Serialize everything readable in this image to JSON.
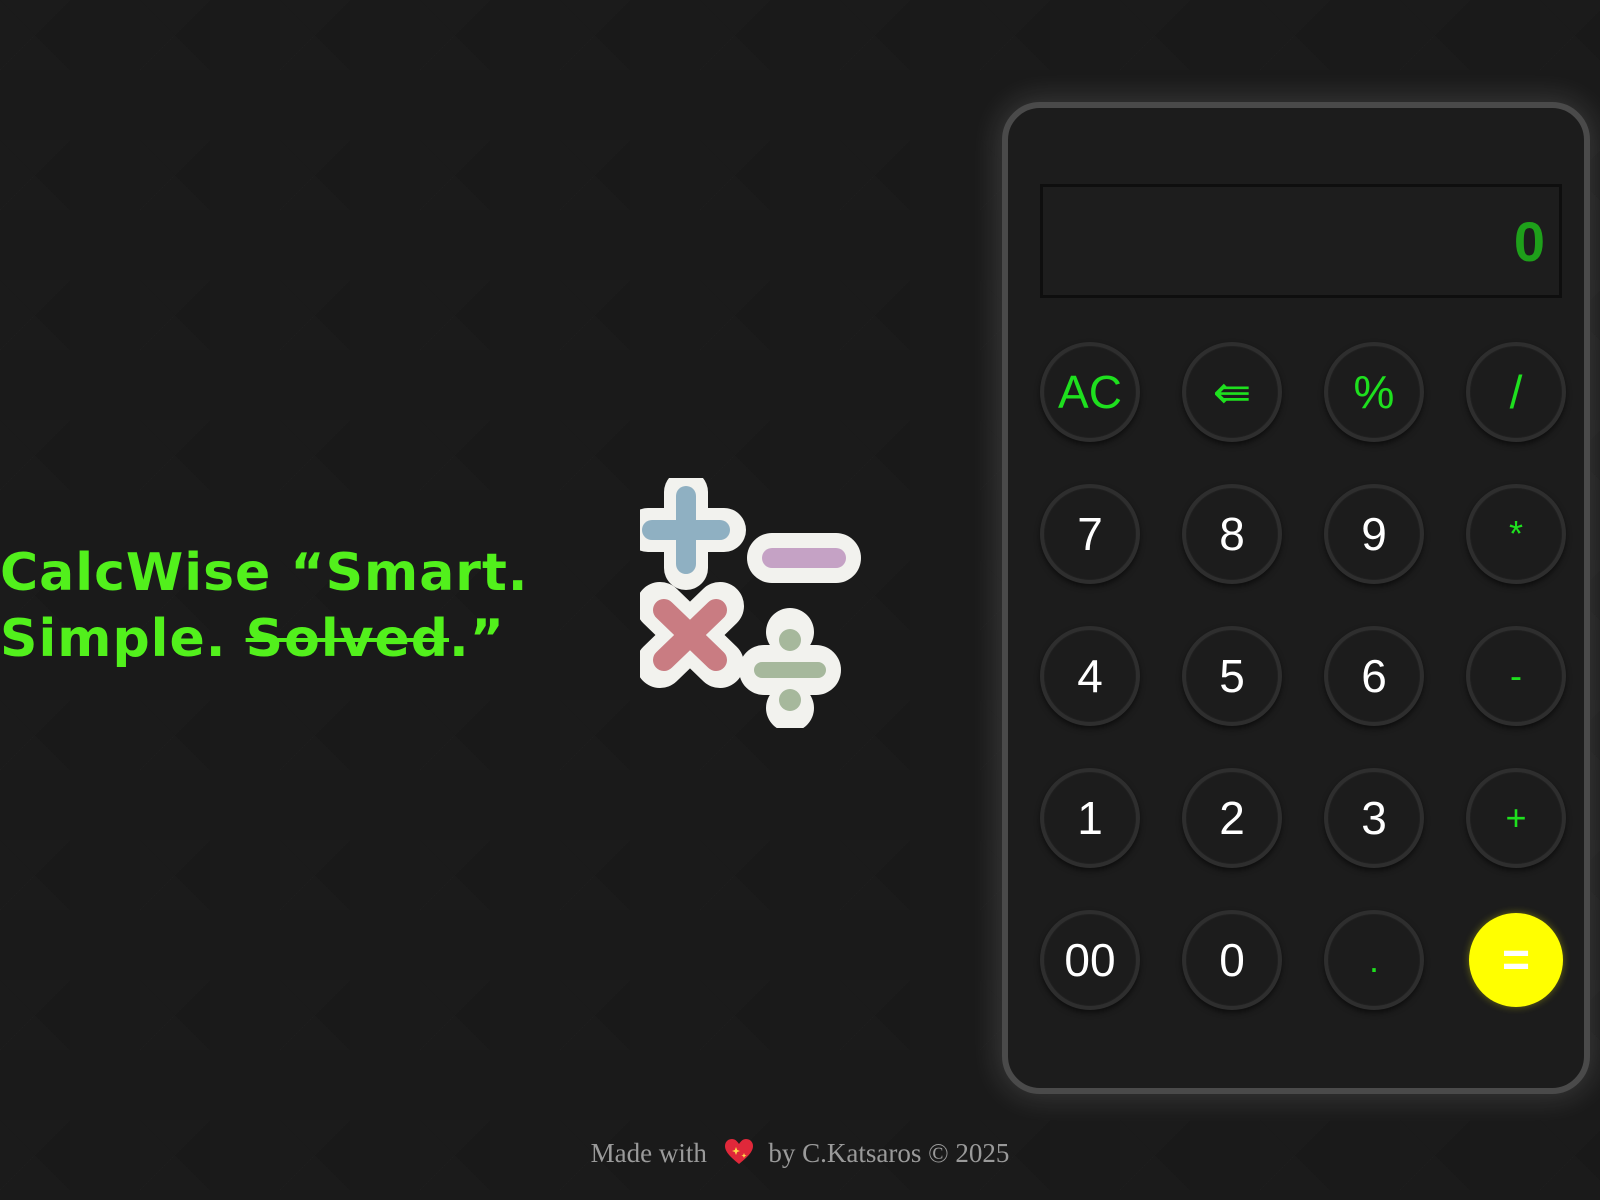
{
  "tagline": {
    "line1": "CalcWise “Smart.",
    "line2_prefix": "Simple. ",
    "line2_strike": "Solved",
    "line2_suffix": ".”"
  },
  "logo": {
    "icon": "math-operators-icon",
    "colors": {
      "plus": "#8fb0c2",
      "minus": "#c5a2c5",
      "times": "#c97c82",
      "divide": "#a6b89c",
      "outline": "#f2f2ee"
    }
  },
  "calculator": {
    "display": "0",
    "keys": [
      {
        "label": "AC",
        "name": "clear-button",
        "kind": "op"
      },
      {
        "label": "⇚",
        "name": "backspace-button",
        "kind": "op"
      },
      {
        "label": "%",
        "name": "percent-button",
        "kind": "op"
      },
      {
        "label": "/",
        "name": "divide-button",
        "kind": "op"
      },
      {
        "label": "7",
        "name": "digit-7-button",
        "kind": "num"
      },
      {
        "label": "8",
        "name": "digit-8-button",
        "kind": "num"
      },
      {
        "label": "9",
        "name": "digit-9-button",
        "kind": "num"
      },
      {
        "label": "*",
        "name": "multiply-button",
        "kind": "op-small"
      },
      {
        "label": "4",
        "name": "digit-4-button",
        "kind": "num"
      },
      {
        "label": "5",
        "name": "digit-5-button",
        "kind": "num"
      },
      {
        "label": "6",
        "name": "digit-6-button",
        "kind": "num"
      },
      {
        "label": "-",
        "name": "subtract-button",
        "kind": "op-small"
      },
      {
        "label": "1",
        "name": "digit-1-button",
        "kind": "num"
      },
      {
        "label": "2",
        "name": "digit-2-button",
        "kind": "num"
      },
      {
        "label": "3",
        "name": "digit-3-button",
        "kind": "num"
      },
      {
        "label": "+",
        "name": "add-button",
        "kind": "op-small"
      },
      {
        "label": "00",
        "name": "double-zero-button",
        "kind": "num"
      },
      {
        "label": "0",
        "name": "digit-0-button",
        "kind": "num"
      },
      {
        "label": ".",
        "name": "decimal-button",
        "kind": "op-small"
      },
      {
        "label": "=",
        "name": "equals-button",
        "kind": "equals"
      }
    ]
  },
  "footer": {
    "prefix": "Made with",
    "icon": "heart-icon",
    "suffix": "by C.Katsaros © 2025"
  },
  "colors": {
    "accent": "#52f01c",
    "operator": "#1ee01e",
    "equals": "#ffff00",
    "display_text": "#1ea01a"
  }
}
